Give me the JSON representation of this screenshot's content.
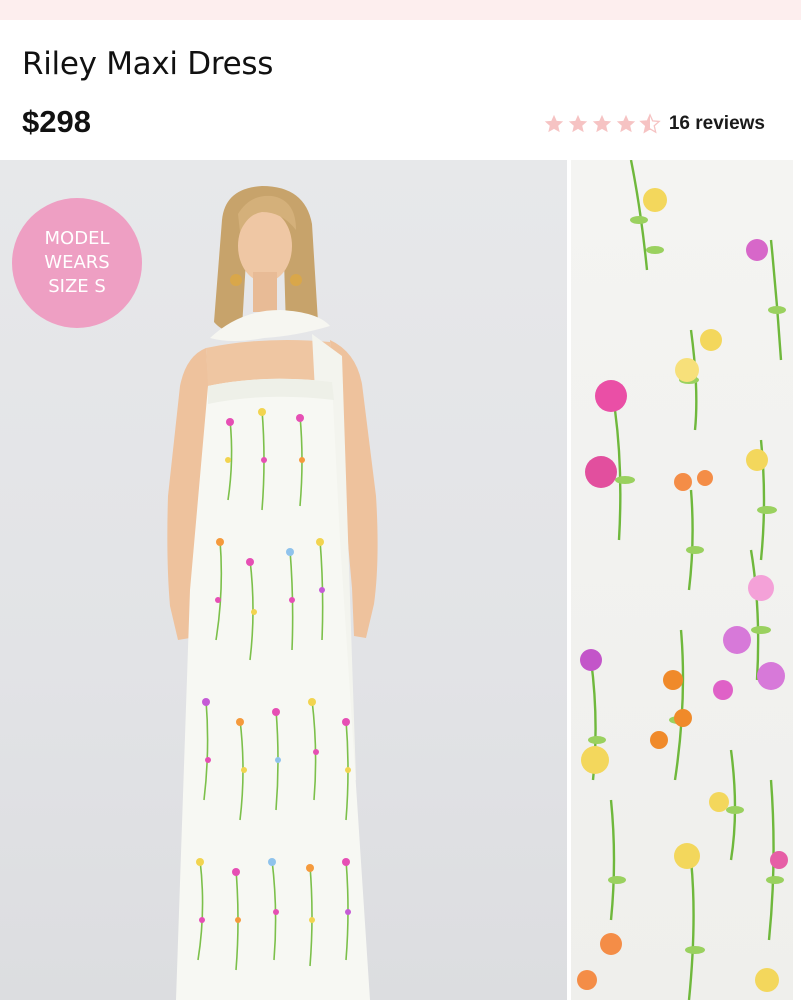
{
  "product": {
    "title": "Riley Maxi Dress",
    "price": "$298"
  },
  "rating": {
    "value": 4.5,
    "max": 5,
    "reviews_label": "16 reviews",
    "star_color": "#f6c3c3"
  },
  "badge": {
    "line1": "MODEL",
    "line2": "WEARS",
    "line3": "SIZE S",
    "color": "#ee9fc3"
  },
  "colors": {
    "promo_band": "#fdeeee",
    "text": "#111111"
  }
}
